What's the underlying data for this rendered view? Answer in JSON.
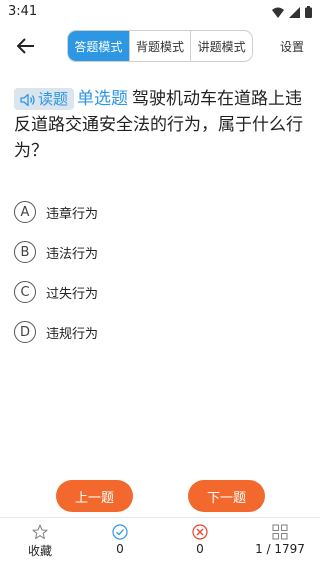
{
  "status": {
    "time": "3:41"
  },
  "header": {
    "modes": [
      "答题模式",
      "背题模式",
      "讲题模式"
    ],
    "active_mode": 0,
    "settings_label": "设置"
  },
  "question": {
    "read_label": "读题",
    "type_label": "单选题",
    "text": "驾驶机动车在道路上违反道路交通安全法的行为，属于什么行为？"
  },
  "options": [
    {
      "letter": "A",
      "text": "违章行为"
    },
    {
      "letter": "B",
      "text": "违法行为"
    },
    {
      "letter": "C",
      "text": "过失行为"
    },
    {
      "letter": "D",
      "text": "违规行为"
    }
  ],
  "nav": {
    "prev_label": "上一题",
    "next_label": "下一题"
  },
  "bottom": {
    "favorite_label": "收藏",
    "correct_count": "0",
    "wrong_count": "0",
    "progress": "1 / 1797"
  },
  "colors": {
    "accent": "#2d97e4",
    "button": "#f3692d",
    "correct": "#2d97e4",
    "wrong": "#e8402c"
  }
}
